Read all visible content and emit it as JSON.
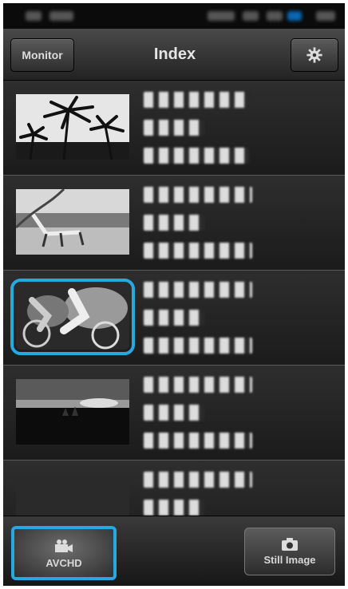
{
  "header": {
    "monitor_label": "Monitor",
    "title": "Index",
    "settings_icon": "gear-icon"
  },
  "list": {
    "items": [
      {
        "thumbnail": "palm-trees-photo",
        "selected": false
      },
      {
        "thumbnail": "beach-chair-photo",
        "selected": false
      },
      {
        "thumbnail": "cyclists-photo",
        "selected": true
      },
      {
        "thumbnail": "sunset-silhouette-photo",
        "selected": false
      },
      {
        "thumbnail": "dark-photo",
        "selected": false
      }
    ]
  },
  "bottom": {
    "avchd_label": "AVCHD",
    "avchd_icon": "movie-camera-icon",
    "still_label": "Still Image",
    "still_icon": "camera-icon"
  },
  "colors": {
    "accent": "#28a8e0",
    "background": "#111111"
  }
}
